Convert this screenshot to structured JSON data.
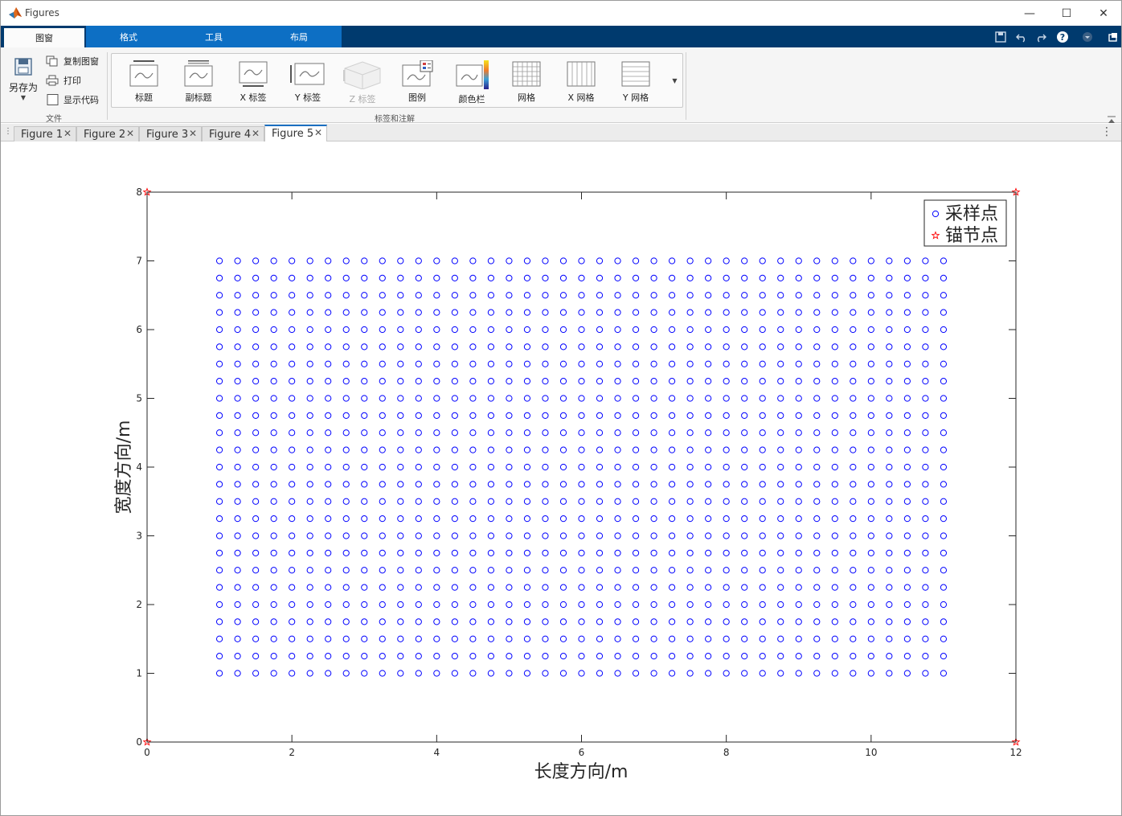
{
  "window": {
    "title": "Figures"
  },
  "window_controls": {
    "minimize": "—",
    "maximize": "☐",
    "close": "✕"
  },
  "ribbon_tabs": [
    "图窗",
    "格式",
    "工具",
    "布局"
  ],
  "file_section": {
    "save_as": "另存为",
    "copy_figure": "复制图窗",
    "print": "打印",
    "show_code": "显示代码",
    "label": "文件"
  },
  "annotations_section": {
    "label": "标签和注解",
    "buttons": [
      {
        "label": "标题",
        "icon": "title-icon"
      },
      {
        "label": "副标题",
        "icon": "subtitle-icon"
      },
      {
        "label": "X 标签",
        "icon": "xlabel-icon"
      },
      {
        "label": "Y 标签",
        "icon": "ylabel-icon"
      },
      {
        "label": "Z 标签",
        "icon": "zlabel-icon",
        "disabled": true
      },
      {
        "label": "图例",
        "icon": "legend-icon"
      },
      {
        "label": "颜色栏",
        "icon": "colorbar-icon"
      },
      {
        "label": "网格",
        "icon": "grid-icon"
      },
      {
        "label": "X 网格",
        "icon": "xgrid-icon"
      },
      {
        "label": "Y 网格",
        "icon": "ygrid-icon"
      }
    ]
  },
  "document_tabs": [
    {
      "label": "Figure 1",
      "active": false
    },
    {
      "label": "Figure 2",
      "active": false
    },
    {
      "label": "Figure 3",
      "active": false
    },
    {
      "label": "Figure 4",
      "active": false
    },
    {
      "label": "Figure 5",
      "active": true
    }
  ],
  "chart_data": {
    "type": "scatter",
    "title": "",
    "xlabel": "长度方向/m",
    "ylabel": "宽度方向/m",
    "xlim": [
      0,
      12
    ],
    "ylim": [
      0,
      8
    ],
    "xticks": [
      0,
      2,
      4,
      6,
      8,
      10,
      12
    ],
    "yticks": [
      0,
      1,
      2,
      3,
      4,
      5,
      6,
      7,
      8
    ],
    "grid": false,
    "legend_position": "top-right",
    "series": [
      {
        "name": "采样点",
        "marker": "circle",
        "color": "#0000ff",
        "grid_spec": {
          "x_start": 1,
          "x_end": 11,
          "x_step": 0.25,
          "y_start": 1,
          "y_end": 7,
          "y_step": 0.25
        }
      },
      {
        "name": "锚节点",
        "marker": "star",
        "color": "#ff0000",
        "points": [
          [
            0,
            0
          ],
          [
            12,
            0
          ],
          [
            0,
            8
          ],
          [
            12,
            8
          ]
        ]
      }
    ]
  }
}
